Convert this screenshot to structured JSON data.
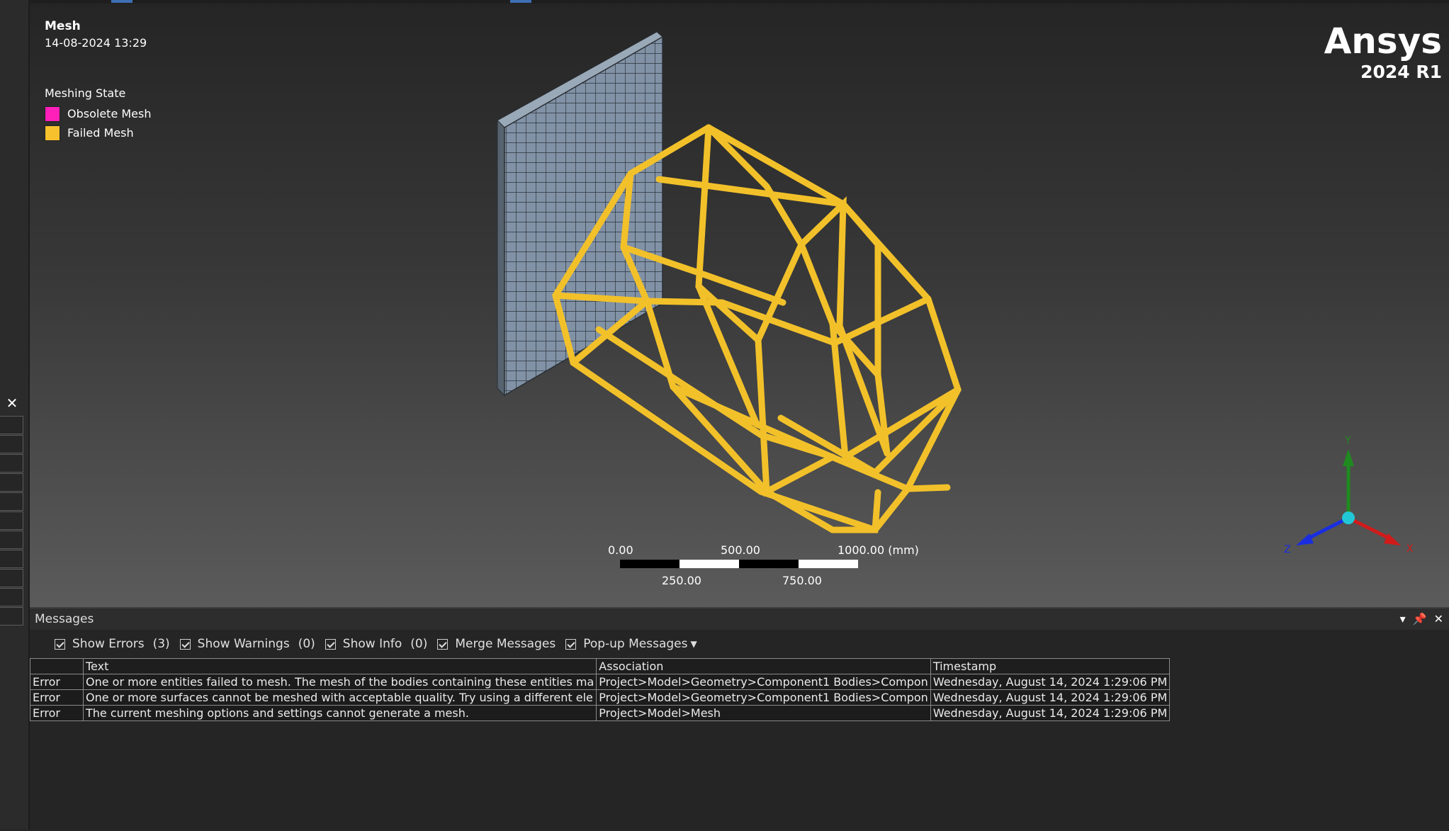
{
  "viewport": {
    "title": "Mesh",
    "date": "14-08-2024 13:29",
    "legend": {
      "title": "Meshing State",
      "items": [
        {
          "label": "Obsolete Mesh",
          "color": "#ff1fb9"
        },
        {
          "label": "Failed Mesh",
          "color": "#f7c12e"
        }
      ]
    },
    "brand": {
      "name": "Ansys",
      "version": "2024 R1"
    },
    "scale": {
      "top_labels": [
        "0.00",
        "500.00",
        "1000.00 (mm)"
      ],
      "bottom_labels": [
        "250.00",
        "750.00"
      ]
    },
    "triad": {
      "x": "X",
      "y": "Y",
      "z": "Z"
    },
    "colors": {
      "frame": "#f2c12a",
      "plate": "#7f8fa1",
      "x_axis": "#d11a1a",
      "y_axis": "#1f8a1f",
      "z_axis": "#1a2ee0",
      "origin": "#22c7d6"
    }
  },
  "messages": {
    "title": "Messages",
    "panel_buttons": [
      "chevron-down-icon",
      "pin-icon",
      "close-icon"
    ],
    "filters": [
      {
        "label": "Show Errors",
        "count": "(3)"
      },
      {
        "label": "Show Warnings",
        "count": "(0)"
      },
      {
        "label": "Show Info",
        "count": "(0)"
      },
      {
        "label": "Merge Messages",
        "count": ""
      },
      {
        "label": "Pop-up Messages",
        "count": ""
      }
    ],
    "columns": [
      "",
      "Text",
      "Association",
      "Timestamp"
    ],
    "rows": [
      {
        "type": "Error",
        "text": "One or more entities failed to mesh. The mesh of the bodies containing these entities ma",
        "association": "Project>Model>Geometry>Component1 Bodies>Compon",
        "timestamp": "Wednesday, August 14, 2024 1:29:06 PM"
      },
      {
        "type": "Error",
        "text": "One or more surfaces cannot be meshed with acceptable quality. Try using a different ele",
        "association": "Project>Model>Geometry>Component1 Bodies>Compon",
        "timestamp": "Wednesday, August 14, 2024 1:29:06 PM"
      },
      {
        "type": "Error",
        "text": "The current meshing options and settings cannot generate a mesh.",
        "association": "Project>Model>Mesh",
        "timestamp": "Wednesday, August 14, 2024 1:29:06 PM"
      }
    ]
  }
}
